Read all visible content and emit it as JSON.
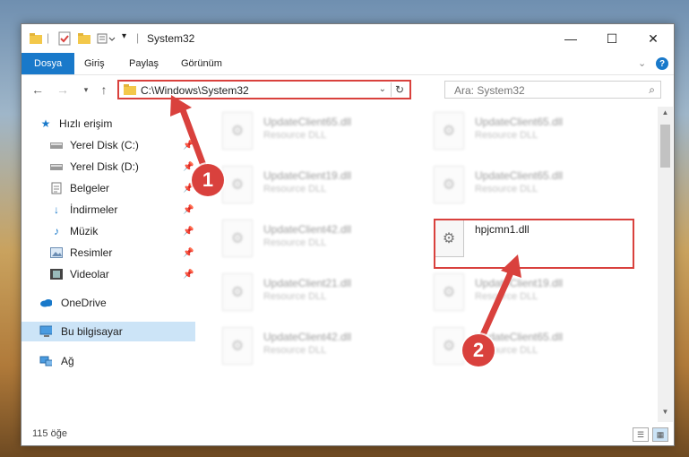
{
  "window": {
    "title": "System32"
  },
  "ribbon": {
    "tabs": [
      "Dosya",
      "Giriş",
      "Paylaş",
      "Görünüm"
    ]
  },
  "address": {
    "path": "C:\\Windows\\System32"
  },
  "search": {
    "placeholder": "Ara: System32"
  },
  "nav": {
    "items": [
      {
        "label": "Hızlı erişim",
        "icon": "star-icon"
      },
      {
        "label": "Yerel Disk (C:)",
        "icon": "drive-icon"
      },
      {
        "label": "Yerel Disk (D:)",
        "icon": "drive-icon"
      },
      {
        "label": "Belgeler",
        "icon": "document-icon"
      },
      {
        "label": "İndirmeler",
        "icon": "download-icon"
      },
      {
        "label": "Müzik",
        "icon": "music-icon"
      },
      {
        "label": "Resimler",
        "icon": "picture-icon"
      },
      {
        "label": "Videolar",
        "icon": "video-icon"
      },
      {
        "label": "OneDrive",
        "icon": "cloud-icon"
      },
      {
        "label": "Bu bilgisayar",
        "icon": "computer-icon"
      },
      {
        "label": "Ağ",
        "icon": "network-icon"
      }
    ]
  },
  "files": [
    {
      "name": "UpdateClient65.dll",
      "type": "Resource DLL"
    },
    {
      "name": "UpdateClient65.dll",
      "type": "Resource DLL"
    },
    {
      "name": "UpdateClient19.dll",
      "type": "Resource DLL"
    },
    {
      "name": "UpdateClient65.dll",
      "type": "Resource DLL"
    },
    {
      "name": "UpdateClient42.dll",
      "type": "Resource DLL"
    },
    {
      "name": "hpjcmn1.dll",
      "type": ""
    },
    {
      "name": "UpdateClient21.dll",
      "type": "Resource DLL"
    },
    {
      "name": "UpdateClient19.dll",
      "type": "Resource DLL"
    },
    {
      "name": "UpdateClient42.dll",
      "type": "Resource DLL"
    },
    {
      "name": "UpdateClient65.dll",
      "type": "Resource DLL"
    }
  ],
  "status": {
    "count": "115 öğe"
  },
  "callouts": {
    "one": "1",
    "two": "2"
  },
  "colors": {
    "accent": "#1979ca",
    "callout": "#d9413d",
    "selection": "#cce4f7"
  }
}
